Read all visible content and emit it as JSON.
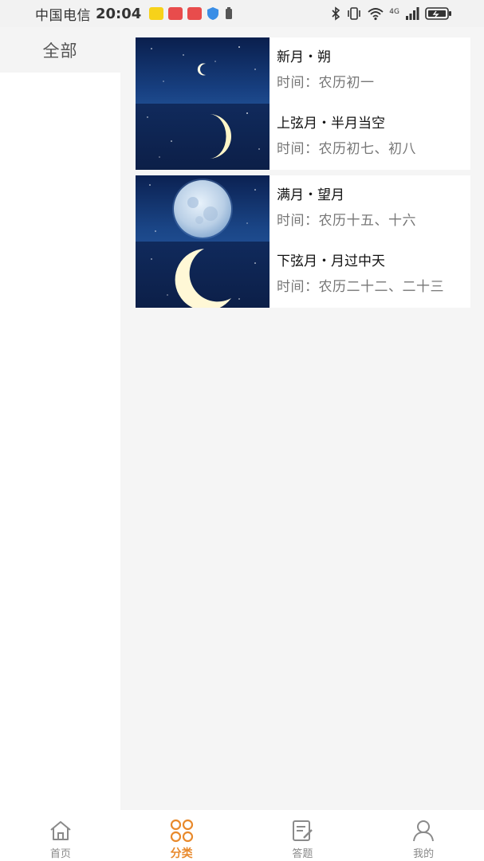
{
  "status_bar": {
    "carrier": "中国电信",
    "time": "20:04",
    "network": "4G"
  },
  "sidebar": {
    "items": [
      {
        "label": "全部",
        "selected": true
      }
    ]
  },
  "cards": [
    {
      "entries": [
        {
          "title": "新月・朔",
          "time": "时间：农历初一",
          "image": "new-moon"
        },
        {
          "title": "上弦月・半月当空",
          "time": "时间：农历初七、初八",
          "image": "first-quarter-moon"
        }
      ]
    },
    {
      "entries": [
        {
          "title": "满月・望月",
          "time": "时间：农历十五、十六",
          "image": "full-moon"
        },
        {
          "title": "下弦月・月过中天",
          "time": "时间：农历二十二、二十三",
          "image": "last-quarter-moon"
        }
      ]
    }
  ],
  "tabbar": {
    "tabs": [
      {
        "label": "首页",
        "icon": "home-icon",
        "active": false
      },
      {
        "label": "分类",
        "icon": "category-icon",
        "active": true
      },
      {
        "label": "答题",
        "icon": "quiz-icon",
        "active": false
      },
      {
        "label": "我的",
        "icon": "profile-icon",
        "active": false
      }
    ]
  },
  "colors": {
    "accent": "#e8892b",
    "sky_dark": "#0d2356",
    "sky_light": "#1f4c8e",
    "content_bg": "#f5f5f5"
  }
}
